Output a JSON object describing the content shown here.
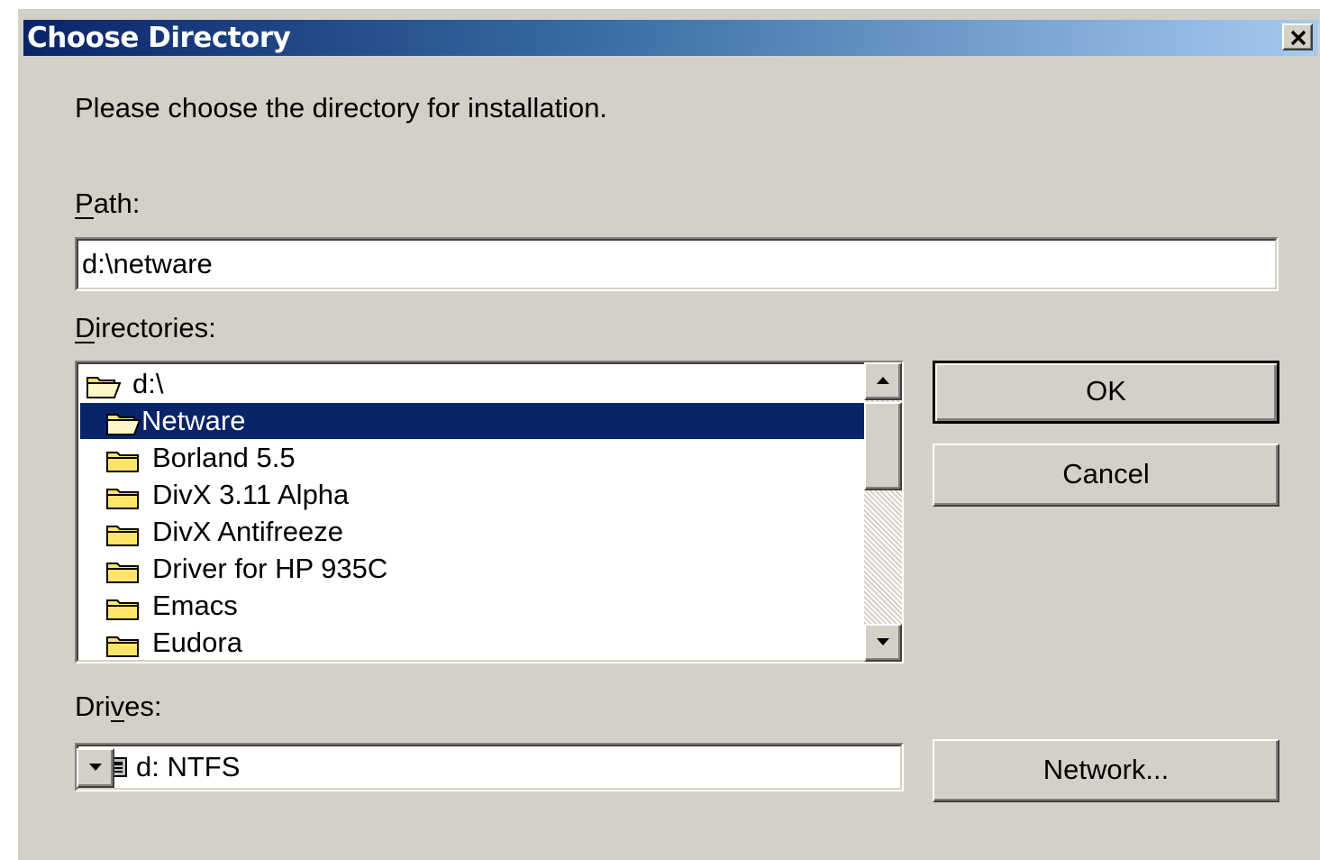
{
  "dialog": {
    "title": "Choose Directory",
    "close_icon": "close-x-icon",
    "prompt": "Please choose the directory for installation.",
    "path": {
      "label_mnemonic": "P",
      "label_rest": "ath:",
      "value": "d:\\netware"
    },
    "directories": {
      "label_mnemonic": "D",
      "label_rest": "irectories:",
      "items": [
        {
          "label": "d:\\",
          "icon": "open-folder-icon",
          "indent": 0,
          "selected": false
        },
        {
          "label": "Netware",
          "icon": "open-folder-icon",
          "indent": 1,
          "selected": true
        },
        {
          "label": "Borland 5.5",
          "icon": "folder-icon",
          "indent": 2,
          "selected": false
        },
        {
          "label": "DivX 3.11 Alpha",
          "icon": "folder-icon",
          "indent": 2,
          "selected": false
        },
        {
          "label": "DivX Antifreeze",
          "icon": "folder-icon",
          "indent": 2,
          "selected": false
        },
        {
          "label": "Driver for HP 935C",
          "icon": "folder-icon",
          "indent": 2,
          "selected": false
        },
        {
          "label": "Emacs",
          "icon": "folder-icon",
          "indent": 2,
          "selected": false
        },
        {
          "label": "Eudora",
          "icon": "folder-icon",
          "indent": 2,
          "selected": false
        }
      ]
    },
    "drives": {
      "label_before": "Dri",
      "label_mnemonic": "v",
      "label_after": "es:",
      "value": "d: NTFS",
      "icon": "hard-drive-icon"
    },
    "buttons": {
      "ok": "OK",
      "cancel": "Cancel",
      "network": "Network..."
    },
    "colors": {
      "face": "#d4d0c8",
      "title_start": "#0a246a",
      "title_end": "#a6caf0",
      "selection": "#0a246a",
      "folder_yellow": "#ffe46b"
    }
  }
}
